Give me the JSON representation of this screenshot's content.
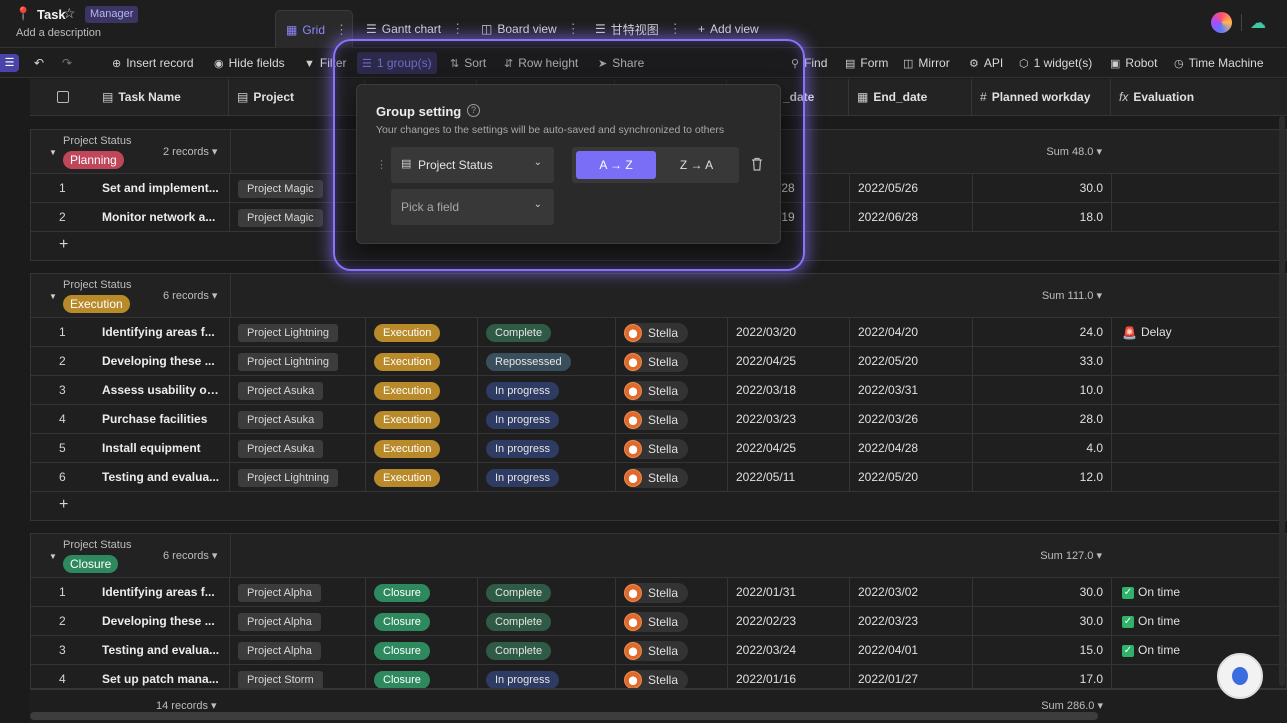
{
  "header": {
    "title": "Task",
    "badge": "Manager",
    "description": "Add a description"
  },
  "tabs": [
    {
      "label": "Grid",
      "icon": "grid-icon",
      "active": true
    },
    {
      "label": "Gantt chart",
      "icon": "gantt-icon",
      "active": false
    },
    {
      "label": "Board view",
      "icon": "board-icon",
      "active": false
    },
    {
      "label": "甘特视图",
      "icon": "gantt-icon",
      "active": false
    },
    {
      "label": "Add view",
      "icon": "plus-icon",
      "active": false
    }
  ],
  "toolbar": {
    "insert": "Insert record",
    "hide": "Hide fields",
    "filter": "Filter",
    "group": "1 group(s)",
    "sort": "Sort",
    "row_height": "Row height",
    "share": "Share",
    "find": "Find",
    "form": "Form",
    "mirror": "Mirror",
    "api": "API",
    "widgets": "1 widget(s)",
    "robot": "Robot",
    "time_machine": "Time Machine"
  },
  "columns": {
    "task": "Task Name",
    "project": "Project",
    "start_date": "_date",
    "end_date": "End_date",
    "planned": "Planned workday",
    "evaluation": "Evaluation"
  },
  "group_setting": {
    "title": "Group setting",
    "subtitle": "Your changes to the settings will be auto-saved and synchronized to others",
    "field": "Project Status",
    "pick_placeholder": "Pick a field",
    "sort_asc": "A → Z",
    "sort_desc": "Z → A"
  },
  "groups": [
    {
      "label": "Project Status",
      "status": "Planning",
      "count": "2 records",
      "sum": "Sum 48.0",
      "rows": [
        {
          "idx": "1",
          "task": "Set and implement...",
          "project": "Project Magic",
          "end": "2022/05/26",
          "start_partial": "/28",
          "planned": "30.0"
        },
        {
          "idx": "2",
          "task": "Monitor network a...",
          "project": "Project Magic",
          "end": "2022/06/28",
          "start_partial": "/19",
          "planned": "18.0"
        }
      ]
    },
    {
      "label": "Project Status",
      "status": "Execution",
      "count": "6 records",
      "sum": "Sum 111.0",
      "rows": [
        {
          "idx": "1",
          "task": "Identifying areas f...",
          "project": "Project Lightning",
          "status": "Execution",
          "progress": "Complete",
          "owner": "Stella",
          "start": "2022/03/20",
          "end": "2022/04/20",
          "planned": "24.0",
          "eval": "Delay"
        },
        {
          "idx": "2",
          "task": "Developing these ...",
          "project": "Project Lightning",
          "status": "Execution",
          "progress": "Repossessed",
          "owner": "Stella",
          "start": "2022/04/25",
          "end": "2022/05/20",
          "planned": "33.0",
          "eval": ""
        },
        {
          "idx": "3",
          "task": "Assess usability of ...",
          "project": "Project Asuka",
          "status": "Execution",
          "progress": "In progress",
          "owner": "Stella",
          "start": "2022/03/18",
          "end": "2022/03/31",
          "planned": "10.0",
          "eval": ""
        },
        {
          "idx": "4",
          "task": "Purchase facilities",
          "project": "Project Asuka",
          "status": "Execution",
          "progress": "In progress",
          "owner": "Stella",
          "start": "2022/03/23",
          "end": "2022/03/26",
          "planned": "28.0",
          "eval": ""
        },
        {
          "idx": "5",
          "task": "Install equipment",
          "project": "Project Asuka",
          "status": "Execution",
          "progress": "In progress",
          "owner": "Stella",
          "start": "2022/04/25",
          "end": "2022/04/28",
          "planned": "4.0",
          "eval": ""
        },
        {
          "idx": "6",
          "task": "Testing and evalua...",
          "project": "Project Lightning",
          "status": "Execution",
          "progress": "In progress",
          "owner": "Stella",
          "start": "2022/05/11",
          "end": "2022/05/20",
          "planned": "12.0",
          "eval": ""
        }
      ]
    },
    {
      "label": "Project Status",
      "status": "Closure",
      "count": "6 records",
      "sum": "Sum 127.0",
      "rows": [
        {
          "idx": "1",
          "task": "Identifying areas f...",
          "project": "Project Alpha",
          "status": "Closure",
          "progress": "Complete",
          "owner": "Stella",
          "start": "2022/01/31",
          "end": "2022/03/02",
          "planned": "30.0",
          "eval": "On time"
        },
        {
          "idx": "2",
          "task": "Developing these ...",
          "project": "Project Alpha",
          "status": "Closure",
          "progress": "Complete",
          "owner": "Stella",
          "start": "2022/02/23",
          "end": "2022/03/23",
          "planned": "30.0",
          "eval": "On time"
        },
        {
          "idx": "3",
          "task": "Testing and evalua...",
          "project": "Project Alpha",
          "status": "Closure",
          "progress": "Complete",
          "owner": "Stella",
          "start": "2022/03/24",
          "end": "2022/04/01",
          "planned": "15.0",
          "eval": "On time"
        },
        {
          "idx": "4",
          "task": "Set up patch mana...",
          "project": "Project Storm",
          "status": "Closure",
          "progress": "In progress",
          "owner": "Stella",
          "start": "2022/01/16",
          "end": "2022/01/27",
          "planned": "17.0",
          "eval": ""
        }
      ]
    }
  ],
  "footer": {
    "count": "14 records",
    "sum": "Sum 286.0"
  },
  "colors": {
    "accent": "#7b6ef6",
    "planning": "#c0465a",
    "execution": "#b98a2a",
    "closure": "#2e8a5e",
    "complete": "#2f5a45",
    "in_progress": "#2e3b63",
    "repossessed": "#3a4f5c"
  }
}
